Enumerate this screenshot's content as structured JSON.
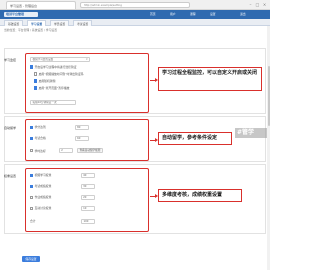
{
  "browser": {
    "tab_title": "学习设置 - 管理后台",
    "url": "http://admin.example/setting",
    "min": "–",
    "max": "□",
    "close": "×"
  },
  "header": {
    "logo": "培训平台管理",
    "links": [
      "首页",
      "用户",
      "课程",
      "设置",
      "退出"
    ]
  },
  "tabs": [
    "基础设置",
    "学习设置",
    "学员设置",
    "考试设置"
  ],
  "breadcrumb": "当前位置：平台管理 / 系统设置 / 学习设置",
  "section1": {
    "label": "学习监控",
    "select": "视频学习监控设置",
    "opt1": "开启后学习过程中将进行监控验证",
    "opt2": "启用“视频播放时间到”时弹出验证码",
    "opt3": "启用随机弹题",
    "opt4": "启用“离开页面”暂停播放",
    "input": "每隔10分钟验证一次",
    "callout": "学习过程全程监控，可以自定义开启或关闭"
  },
  "section2": {
    "label": "自动留学",
    "row1_label": "学分达到",
    "row1_value": "80",
    "row2_label": "考试合格",
    "row2_value": "60",
    "row3_label": "学时达标",
    "row3_value": "2",
    "row3_btn": "查看自动留学规则",
    "callout": "自动留学，参考条件设定",
    "stamp": "#管学"
  },
  "section3": {
    "label": "权重设置",
    "rows": [
      {
        "label": "视频学习权重",
        "value": "40"
      },
      {
        "label": "考试成绩权重",
        "value": "30"
      },
      {
        "label": "作业成绩权重",
        "value": "20"
      },
      {
        "label": "互动讨论权重",
        "value": "10"
      },
      {
        "label": "合计",
        "value": "100"
      }
    ],
    "callout": "多维度考核，成绩权重设置"
  },
  "save_label": "保存设置",
  "colors": {
    "primary": "#2f6ab0",
    "highlight": "#d9302c",
    "button": "#3b7ddd"
  }
}
